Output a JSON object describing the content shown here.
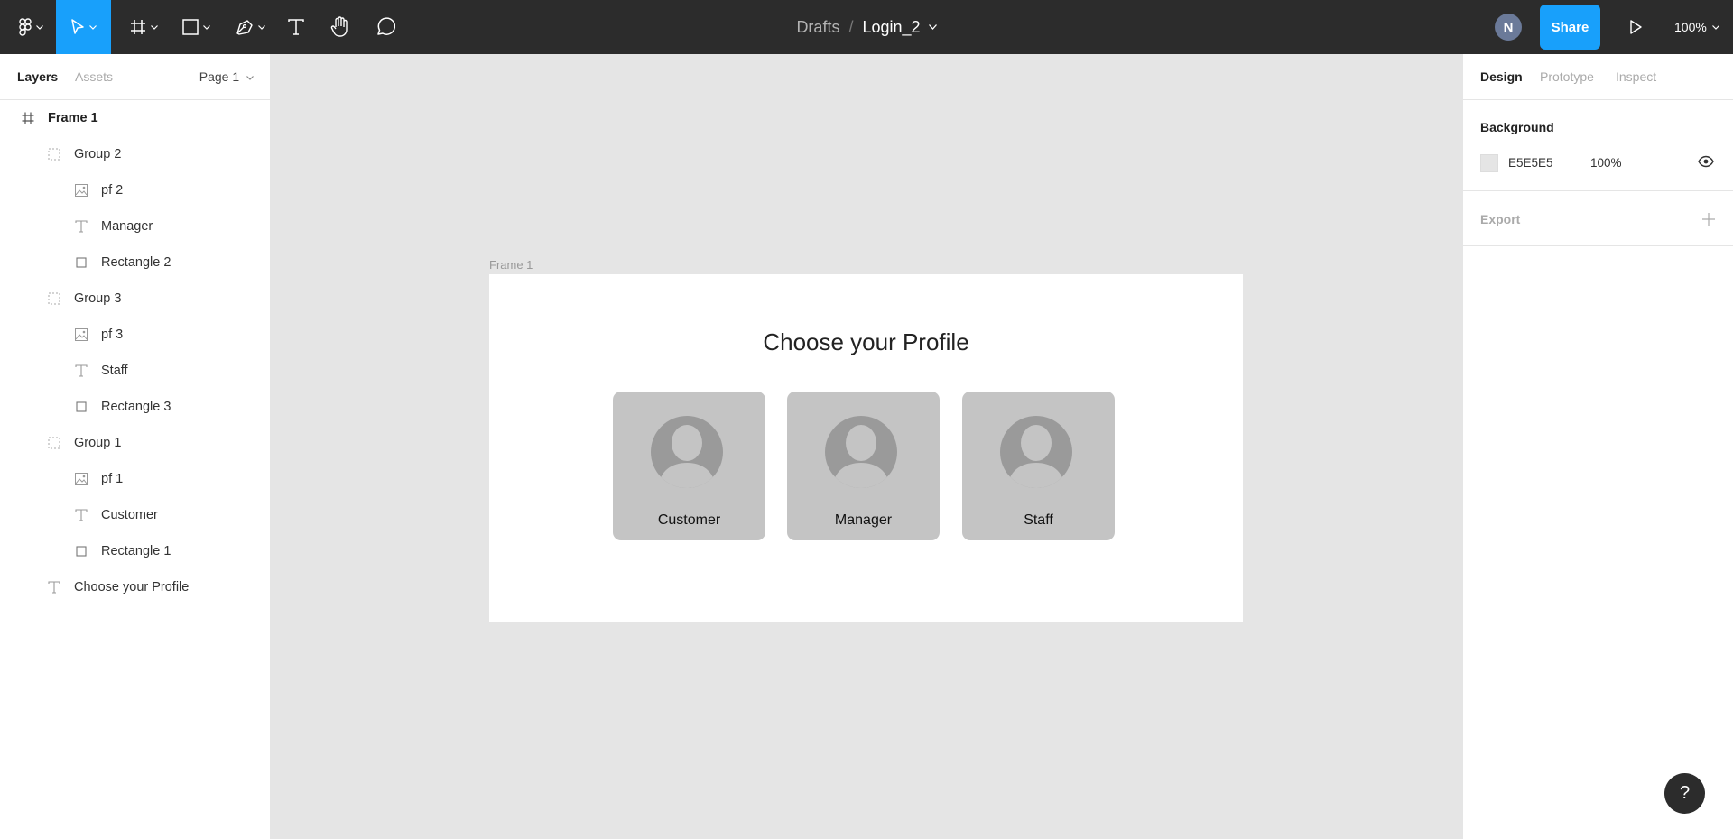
{
  "toolbar": {
    "tools": [
      "main-menu",
      "move",
      "frame",
      "shape",
      "pen",
      "text",
      "hand",
      "comment"
    ],
    "breadcrumb": {
      "root": "Drafts",
      "separator": "/",
      "file": "Login_2"
    },
    "avatar_initial": "N",
    "share_label": "Share",
    "zoom_label": "100%"
  },
  "left_panel": {
    "tabs": [
      {
        "label": "Layers"
      },
      {
        "label": "Assets"
      }
    ],
    "page_select": "Page 1",
    "layers": [
      {
        "label": "Frame 1",
        "icon": "frame-icon"
      },
      {
        "label": "Group 2",
        "icon": "group-icon"
      },
      {
        "label": "pf 2",
        "icon": "image-icon"
      },
      {
        "label": "Manager",
        "icon": "text-icon"
      },
      {
        "label": "Rectangle 2",
        "icon": "rectangle-icon"
      },
      {
        "label": "Group 3",
        "icon": "group-icon"
      },
      {
        "label": "pf 3",
        "icon": "image-icon"
      },
      {
        "label": "Staff",
        "icon": "text-icon"
      },
      {
        "label": "Rectangle 3",
        "icon": "rectangle-icon"
      },
      {
        "label": "Group 1",
        "icon": "group-icon"
      },
      {
        "label": "pf 1",
        "icon": "image-icon"
      },
      {
        "label": "Customer",
        "icon": "text-icon"
      },
      {
        "label": "Rectangle 1",
        "icon": "rectangle-icon"
      },
      {
        "label": "Choose your Profile",
        "icon": "text-icon"
      }
    ]
  },
  "canvas": {
    "frame_label": "Frame 1",
    "title": "Choose your Profile",
    "cards": [
      {
        "label": "Customer"
      },
      {
        "label": "Manager"
      },
      {
        "label": "Staff"
      }
    ]
  },
  "right_panel": {
    "tabs": [
      {
        "label": "Design"
      },
      {
        "label": "Prototype"
      },
      {
        "label": "Inspect"
      }
    ],
    "background": {
      "title": "Background",
      "hex": "E5E5E5",
      "opacity": "100%"
    },
    "export": {
      "title": "Export"
    }
  },
  "help_label": "?",
  "colors": {
    "toolbar": "#2c2c2c",
    "accent": "#18a0fb",
    "canvas": "#e5e5e5",
    "card": "#c4c4c4",
    "avatar_icon": "#9a9a9a"
  }
}
